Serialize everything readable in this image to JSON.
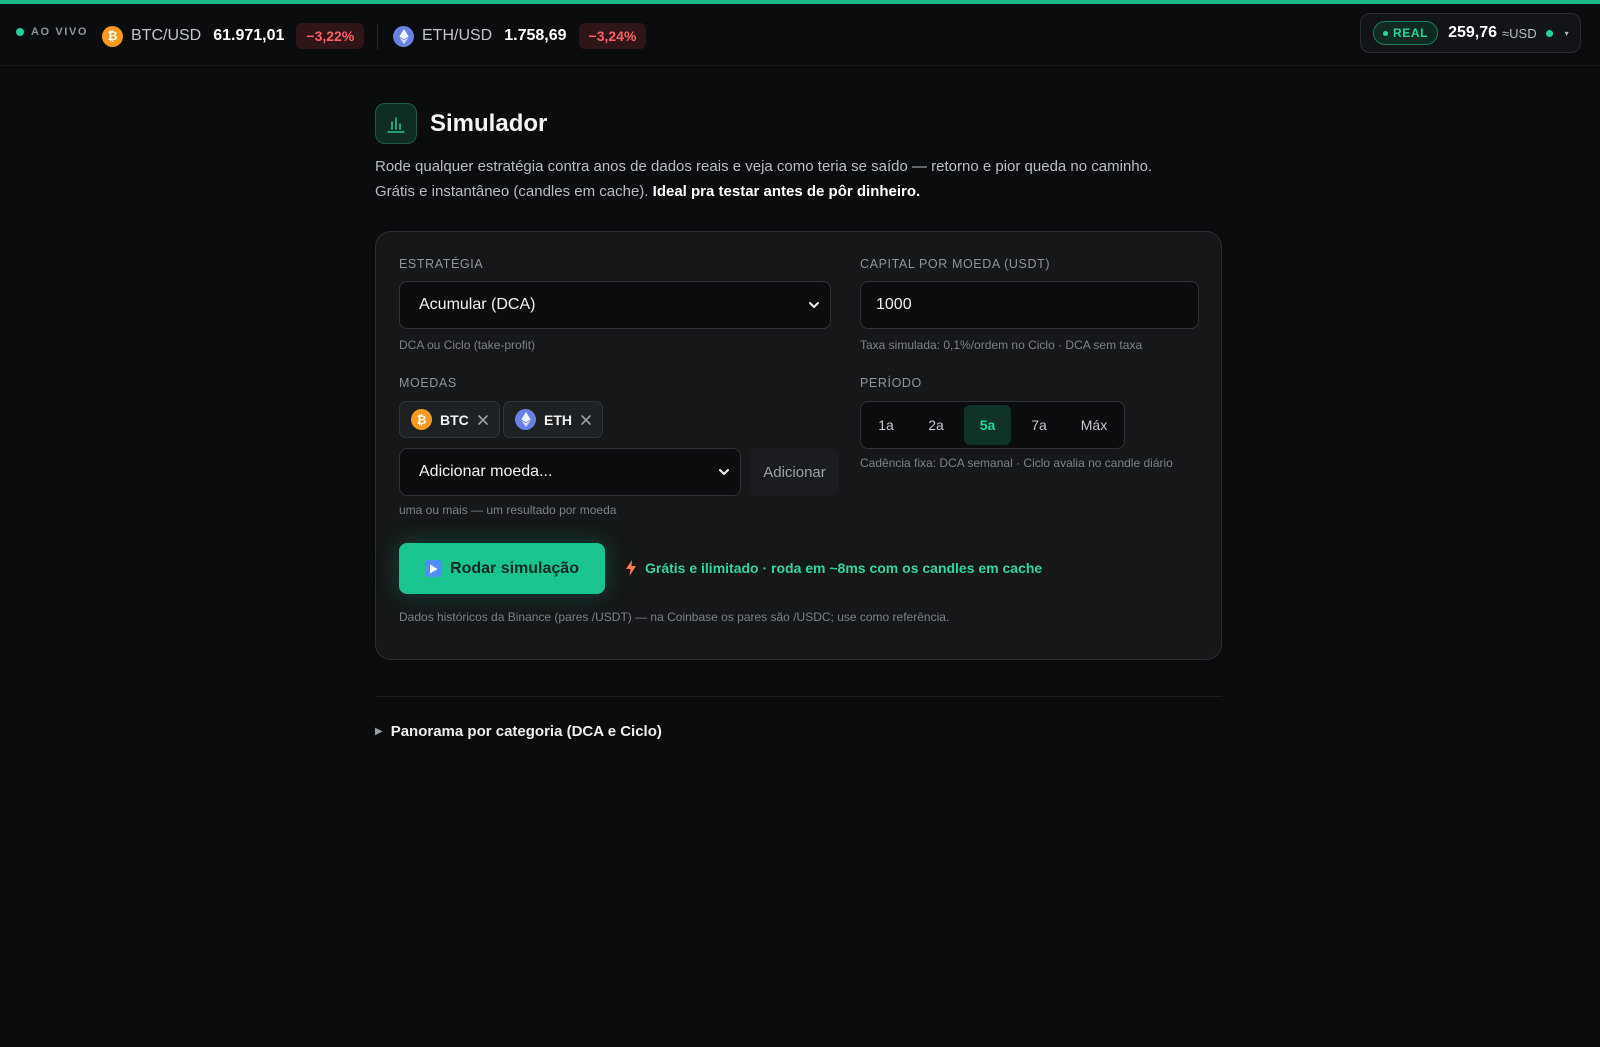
{
  "colors": {
    "accent": "#19c48e",
    "negative": "#ff5f66",
    "background": "#0b0c0e",
    "card": "#151719"
  },
  "ticker": {
    "live_label": "AO VIVO",
    "btc": {
      "icon": "bitcoin-icon",
      "pair": "BTC/USD",
      "price": "61.971,01",
      "change": "−3,22%"
    },
    "eth": {
      "icon": "ethereum-icon",
      "pair": "ETH/USD",
      "price": "1.758,69",
      "change": "−3,24%"
    }
  },
  "account": {
    "mode": "REAL",
    "balance": "259,76",
    "unit": "≈USD"
  },
  "page": {
    "icon": "bar-chart-icon",
    "title": "Simulador",
    "intro_line1": "Rode qualquer estratégia contra anos de dados reais e veja como teria se saído — retorno e pior queda no caminho.",
    "intro_line2": "Grátis e instantâneo (candles em cache).",
    "intro_strong": "Ideal pra testar antes de pôr dinheiro."
  },
  "form": {
    "strategy": {
      "label": "ESTRATÉGIA",
      "value": "Acumular (DCA)",
      "help": "DCA ou Ciclo (take-profit)"
    },
    "capital": {
      "label": "CAPITAL POR MOEDA (USDT)",
      "value": "1000",
      "help": "Taxa simulada: 0,1%/ordem no Ciclo · DCA sem taxa"
    },
    "coins": {
      "label": "MOEDAS",
      "selected": [
        {
          "symbol": "BTC",
          "icon": "bitcoin-icon"
        },
        {
          "symbol": "ETH",
          "icon": "ethereum-icon"
        }
      ],
      "add_placeholder": "Adicionar moeda...",
      "add_button": "Adicionar",
      "help": "uma ou mais — um resultado por moeda"
    },
    "period": {
      "label": "PERÍODO",
      "options": [
        "1a",
        "2a",
        "5a",
        "7a",
        "Máx"
      ],
      "selected": "5a",
      "help": "Cadência fixa: DCA semanal · Ciclo avalia no candle diário"
    },
    "run_button": "Rodar simulação",
    "promo": "Grátis e ilimitado · roda em ~8ms com os candles em cache",
    "footnote": "Dados históricos da Binance (pares /USDT) — na Coinbase os pares são /USDC; use como referência."
  },
  "details": {
    "label": "Panorama por categoria (DCA e Ciclo)"
  }
}
